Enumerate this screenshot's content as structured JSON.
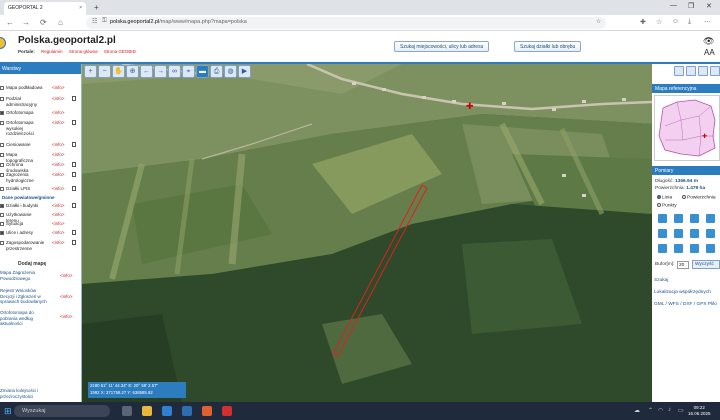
{
  "browser": {
    "tab_title": "GEOPORTAL 2",
    "tab_close": "×",
    "new_tab": "+",
    "window_controls": [
      "—",
      "❐",
      "✕"
    ],
    "url_host": "polska.geoportal2.pl",
    "url_path": "/map/www/mapa.php?mapa=polska",
    "nav_icons": [
      "back-arrow-icon",
      "forward-arrow-icon",
      "reload-icon",
      "home-icon"
    ]
  },
  "header": {
    "site_title": "Polska.geoportal2.pl",
    "links_label": "Portale:",
    "links": [
      "Regulamin",
      "Strona główna",
      "Strona GEOBID"
    ],
    "search_address_button": "Szukaj miejscowości, ulicy lub adresu",
    "search_parcel_button": "Szukaj działki lub obrębu",
    "contrast_icon": "eye-icon",
    "font_size_icon": "AA"
  },
  "left_panel": {
    "header": "Warstwy",
    "layers": [
      {
        "name": "Mapa podkładowa",
        "info": "<info>",
        "checked": false
      },
      {
        "name": "Podział administracyjny",
        "info": "<info>",
        "checked": false
      },
      {
        "name": "Ortofotomapa",
        "info": "<info>",
        "checked": true
      },
      {
        "name": "Ortofotomapa wysokiej rozdzielczości",
        "info": "<info>",
        "checked": false
      },
      {
        "name": "Cieniowanie",
        "info": "<info>",
        "checked": false
      },
      {
        "name": "Mapa topograficzna",
        "info": "<info>",
        "checked": false
      },
      {
        "name": "Ochrona środowiska",
        "info": "<info>",
        "checked": false
      },
      {
        "name": "Zagrożenia hydrologiczne",
        "info": "<info>",
        "checked": false
      },
      {
        "name": "Działki LPIS",
        "info": "<info>",
        "checked": false
      }
    ],
    "section_title": "Dane powiatowe/gminne",
    "local_layers": [
      {
        "name": "Działki i budynki",
        "info": "<info>",
        "checked": true
      },
      {
        "name": "Użytkowanie terenu",
        "info": "<info>",
        "checked": false
      },
      {
        "name": "Sytuacja",
        "info": "<info>",
        "checked": false
      },
      {
        "name": "Ulice i adresy",
        "info": "<info>",
        "checked": true
      },
      {
        "name": "Zagospodarowanie przestrzenne",
        "info": "<info>",
        "checked": false
      }
    ],
    "add_map_label": "Dodaj mapę",
    "extra_layers": [
      {
        "name": "Mapa Zagrożenia Powodziowego",
        "info": "<info>"
      },
      {
        "name": "Rejestr Wniosków Decyzji i Zgłoszeń w sprawach budowlanych",
        "info": "<info>"
      },
      {
        "name": "Ortofotomapa do pobrania według aktualności",
        "info": "<info>"
      }
    ],
    "bottom_link": "Zmiana kolejności i przezroczystości"
  },
  "map": {
    "toolbar_icons": [
      "zoom-in-icon",
      "zoom-out-icon",
      "pan-hand-icon",
      "zoom-extent-icon",
      "back-icon",
      "forward-icon",
      "link-icon",
      "measure-icon",
      "ruler-icon",
      "print-icon",
      "camera-icon",
      "video-icon"
    ],
    "coords_lines": [
      "2180  51° 11' 44.34\"   E: 20° 59' 2.57\"",
      "1992  X: 371758.27     Y: 638585.92"
    ]
  },
  "right_panel": {
    "tool_icons": [
      "layout-icon",
      "layout-icon",
      "layout-icon",
      "layout-icon"
    ],
    "overview_header": "Mapa referencyjna",
    "measure_header": "Pomiary",
    "length_label": "Długość:",
    "length_value": "1366.94 m",
    "area_label": "Powierzchnia:",
    "area_value": "1.478 ha",
    "radio_line": "Linia",
    "radio_area": "Powierzchnia",
    "radio_points": "Punkty",
    "buffer_label": "Bufor[m]:",
    "buffer_value": "20",
    "clear_button": "Wyczyść",
    "sections": [
      "Szukaj",
      "Lokalizacja współrzędnych",
      "GML / WFS / DXF / GPX Pliki"
    ]
  },
  "taskbar": {
    "search_placeholder": "Wyszukaj",
    "time": "09:22",
    "date": "16.06.2025"
  }
}
